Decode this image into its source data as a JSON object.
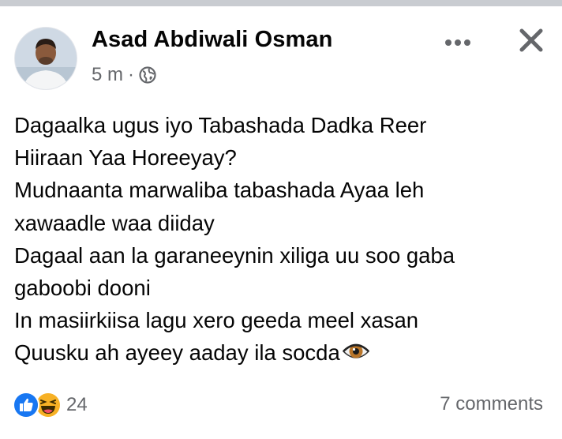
{
  "post": {
    "author": "Asad Abdiwali Osman",
    "time": "5 m",
    "separator": "·",
    "privacy_icon": "globe-icon",
    "lines": [
      "Dagaalka ugus iyo Tabashada Dadka Reer",
      "Hiiraan Yaa Horeeyay?",
      "Mudnaanta marwaliba tabashada Ayaa leh",
      "xawaadle waa diiday",
      "Dagaal aan la garaneeynin xiliga uu soo gaba",
      "gaboobi dooni",
      "In masiirkiisa lagu xero geeda meel xasan",
      "Quusku ah ayeey aaday ila socda"
    ],
    "emoji": "eye-emoji"
  },
  "actions": {
    "more_icon": "more-horizontal-icon",
    "close_icon": "close-icon"
  },
  "footer": {
    "reaction_icons": [
      "like-icon",
      "haha-icon"
    ],
    "reaction_count": "24",
    "comments": "7 comments"
  },
  "colors": {
    "text": "#050505",
    "secondary": "#65676b",
    "like_blue": "#1877f2",
    "haha_yellow": "#f7b125",
    "strip": "#c9ccd1"
  }
}
